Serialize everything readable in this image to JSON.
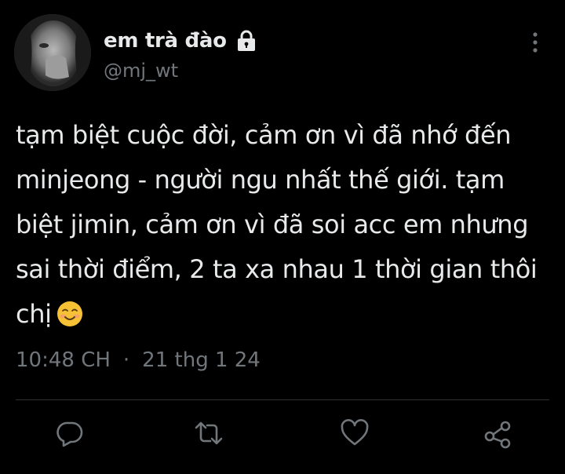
{
  "author": {
    "display_name": "em trà đào",
    "handle": "@mj_wt",
    "protected_icon": "lock-icon",
    "avatar": "avatar-photo"
  },
  "tweet": {
    "text": "tạm biệt cuộc đời, cảm ơn vì đã nhớ đến\nminjeong - người ngu nhất thế giới. tạm\nbiệt jimin, cảm ơn vì đã soi acc em nhưng\nsai thời điểm, 2 ta xa nhau 1 thời gian thôi\nchị",
    "emoji": "smiling-face-emoji",
    "time": "10:48 CH",
    "separator": "·",
    "date": "21 thg 1 24"
  },
  "actions": [
    {
      "name": "reply",
      "icon": "reply-icon"
    },
    {
      "name": "retweet",
      "icon": "retweet-icon"
    },
    {
      "name": "like",
      "icon": "heart-icon"
    },
    {
      "name": "share",
      "icon": "share-icon"
    }
  ],
  "colors": {
    "background": "#000000",
    "text": "#e7e9ea",
    "secondary": "#71767b",
    "divider": "#2f3336"
  }
}
